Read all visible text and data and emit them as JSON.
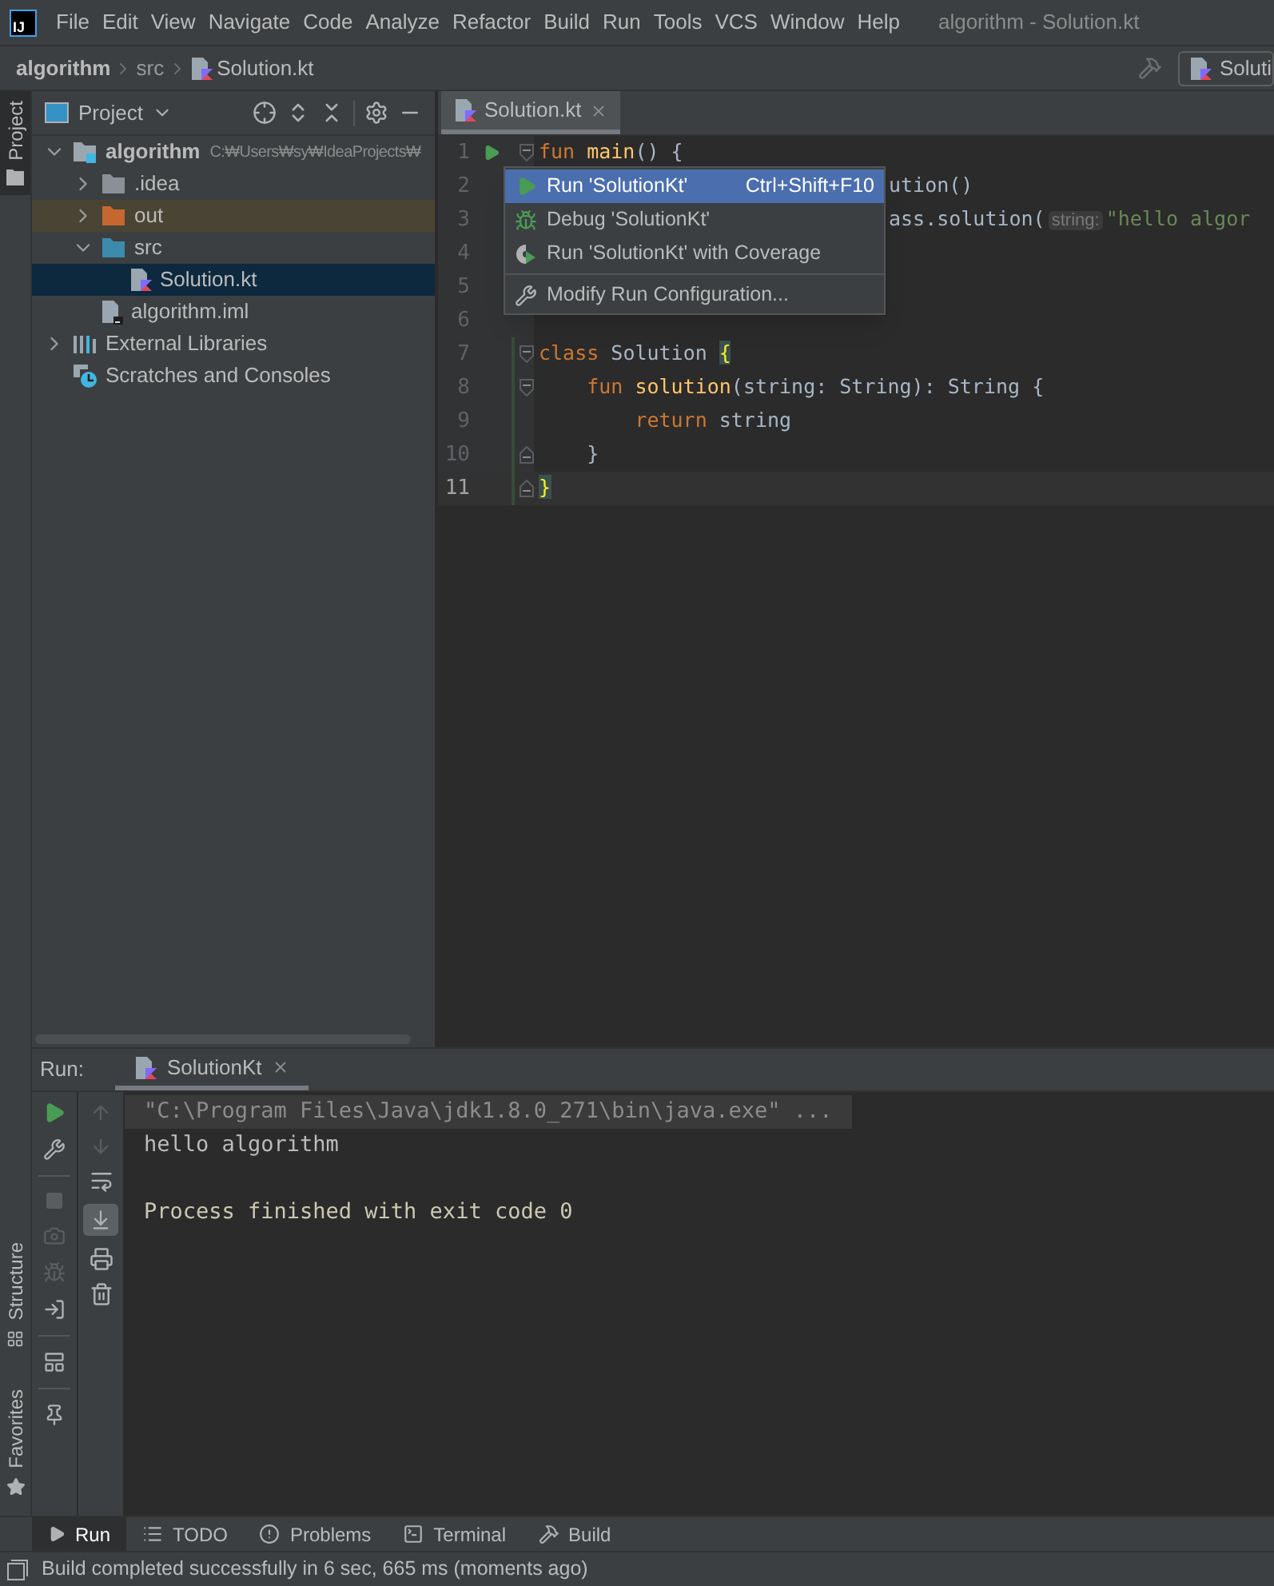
{
  "menu_bar": {
    "logo": "IJ",
    "items": [
      "File",
      "Edit",
      "View",
      "Navigate",
      "Code",
      "Analyze",
      "Refactor",
      "Build",
      "Run",
      "Tools",
      "VCS",
      "Window",
      "Help"
    ],
    "title": "algorithm - Solution.kt"
  },
  "nav_bar": {
    "breadcrumbs": [
      {
        "label": "algorithm",
        "kind": "project"
      },
      {
        "label": "src",
        "kind": "folder"
      },
      {
        "label": "Solution.kt",
        "kind": "kotlin"
      }
    ],
    "run_config": "Soluti"
  },
  "left_stripe": [
    {
      "label": "Project",
      "selected": true,
      "kind": "project"
    },
    {
      "label": "Structure",
      "selected": false,
      "kind": "structure"
    },
    {
      "label": "Favorites",
      "selected": false,
      "kind": "favorites"
    }
  ],
  "project_panel": {
    "title": "Project",
    "tree": [
      {
        "label": "algorithm",
        "path": "C:₩Users₩sy₩IdeaProjects₩",
        "kind": "module",
        "expanded": true,
        "selected": false,
        "children": [
          {
            "label": ".idea",
            "kind": "folder",
            "expanded": false,
            "selected": false
          },
          {
            "label": "out",
            "kind": "excluded",
            "expanded": false,
            "selected": false
          },
          {
            "label": "src",
            "kind": "source",
            "expanded": true,
            "selected": false,
            "children": [
              {
                "label": "Solution.kt",
                "kind": "kotlin",
                "selected": true
              }
            ]
          },
          {
            "label": "algorithm.iml",
            "kind": "iml",
            "selected": false
          }
        ]
      },
      {
        "label": "External Libraries",
        "kind": "libraries",
        "expanded": false,
        "selected": false
      },
      {
        "label": "Scratches and Consoles",
        "kind": "scratches",
        "selected": false
      }
    ]
  },
  "editor": {
    "tabs": [
      {
        "label": "Solution.kt",
        "selected": true
      }
    ],
    "lines": [
      {
        "number": "1",
        "run": true,
        "fold_start": true,
        "tokens": [
          {
            "kind": "keyword",
            "text": "fun"
          },
          {
            "kind": "function",
            "text": " main"
          },
          {
            "kind": "plain",
            "text": "() {"
          }
        ]
      },
      {
        "number": "2",
        "covered": true,
        "tokens": [
          {
            "kind": "plain",
            "text": "ution()"
          }
        ]
      },
      {
        "number": "3",
        "covered": true,
        "tokens": [
          {
            "kind": "plain",
            "text": "ass.solution("
          },
          {
            "kind": "hint",
            "text": "string:"
          },
          {
            "kind": "string",
            "text": "\"hello algor"
          }
        ]
      },
      {
        "number": "4"
      },
      {
        "number": "5"
      },
      {
        "number": "6"
      },
      {
        "number": "7",
        "fold_start": true,
        "added": true,
        "tokens": [
          {
            "kind": "keyword",
            "text": "class"
          },
          {
            "kind": "plain",
            "text": " Solution "
          },
          {
            "kind": "brace",
            "text": "{"
          }
        ]
      },
      {
        "number": "8",
        "fold_start": true,
        "added": true,
        "tokens": [
          {
            "kind": "keyword",
            "text": "    fun"
          },
          {
            "kind": "function",
            "text": " solution"
          },
          {
            "kind": "plain",
            "text": "(string: String): String {"
          }
        ]
      },
      {
        "number": "9",
        "added": true,
        "tokens": [
          {
            "kind": "keyword",
            "text": "        return"
          },
          {
            "kind": "plain",
            "text": " string"
          }
        ]
      },
      {
        "number": "10",
        "fold_end": true,
        "added": true,
        "tokens": [
          {
            "kind": "plain",
            "text": "    }"
          }
        ]
      },
      {
        "number": "11",
        "fold_end": true,
        "added": true,
        "current": true,
        "tokens": [
          {
            "kind": "brace",
            "text": "}"
          }
        ]
      }
    ],
    "popup": [
      {
        "kind": "run",
        "label": "Run 'SolutionKt'",
        "shortcut": "Ctrl+Shift+F10",
        "selected": true
      },
      {
        "kind": "debug",
        "label": "Debug 'SolutionKt'",
        "selected": false
      },
      {
        "kind": "coverage",
        "label": "Run 'SolutionKt' with Coverage",
        "selected": false
      },
      {
        "kind": "modify",
        "label": "Modify Run Configuration...",
        "selected": false
      }
    ]
  },
  "run_panel": {
    "title": "Run:",
    "tabs": [
      {
        "label": "SolutionKt",
        "selected": true
      }
    ],
    "scroll_to_end": true,
    "console": [
      {
        "kind": "command",
        "text": "\"C:\\Program Files\\Java\\jdk1.8.0_271\\bin\\java.exe\" ..."
      },
      {
        "kind": "output",
        "text": "hello algorithm"
      },
      {
        "kind": "exit",
        "text": "Process finished with exit code 0"
      }
    ]
  },
  "tool_tabs": [
    {
      "label": "Run",
      "kind": "run",
      "selected": true
    },
    {
      "label": "TODO",
      "kind": "todo",
      "selected": false
    },
    {
      "label": "Problems",
      "kind": "problems",
      "selected": false
    },
    {
      "label": "Terminal",
      "kind": "terminal",
      "selected": false
    },
    {
      "label": "Build",
      "kind": "build",
      "selected": false
    }
  ],
  "status_bar": {
    "message": "Build completed successfully in 6 sec, 665 ms (moments ago)"
  }
}
